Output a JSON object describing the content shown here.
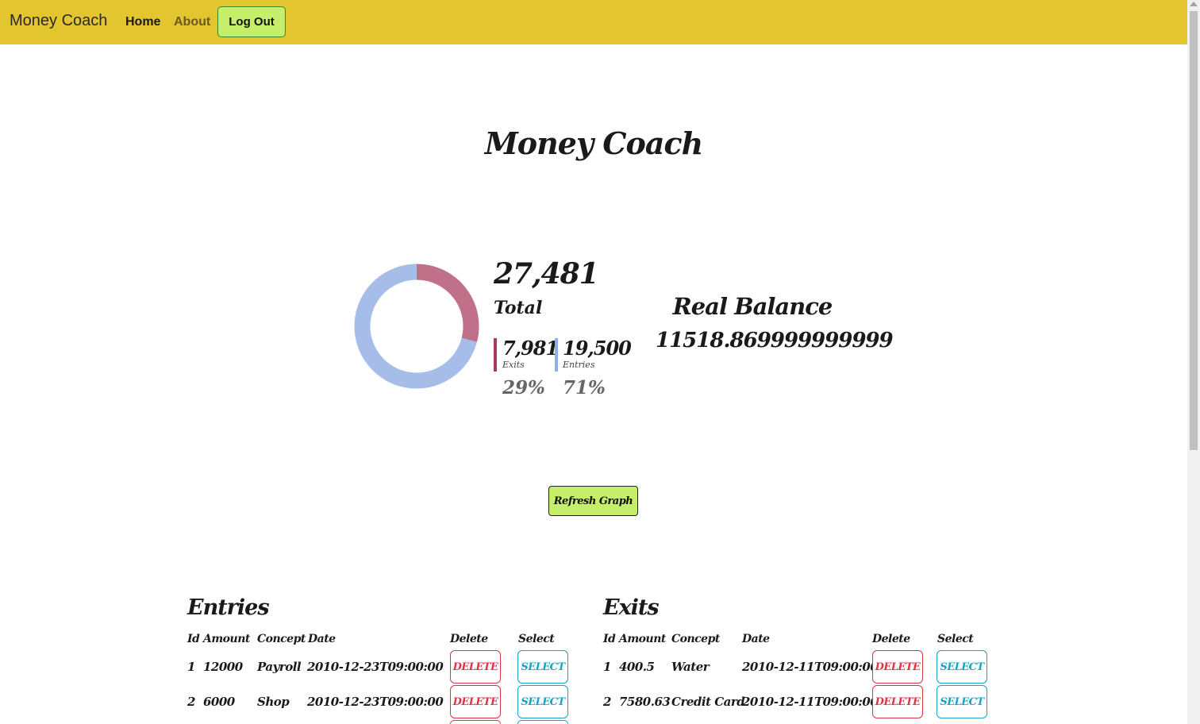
{
  "nav": {
    "brand": "Money Coach",
    "home": "Home",
    "about": "About",
    "logout": "Log Out"
  },
  "page_title": "Money Coach",
  "summary": {
    "total_value": "27,481",
    "total_label": "Total",
    "exits_value": "7,981",
    "exits_label": "Exits",
    "exits_percent": "29%",
    "entries_value": "19,500",
    "entries_label": "Entries",
    "entries_percent": "71%"
  },
  "chart_data": {
    "type": "pie",
    "categories": [
      "Exits",
      "Entries"
    ],
    "values": [
      7981,
      19500
    ],
    "colors": [
      "#c07088",
      "#a5bde8"
    ]
  },
  "real_balance": {
    "title": "Real Balance",
    "value": "11518.869999999999"
  },
  "refresh_button": "Refresh Graph",
  "entries": {
    "title": "Entries",
    "headers": [
      "Id",
      "Amount",
      "Concept",
      "Date",
      "Delete",
      "Select"
    ],
    "rows": [
      {
        "id": "1",
        "amount": "12000",
        "concept": "Payroll",
        "date": "2010-12-23T09:00:00",
        "delete": "DELETE",
        "select": "SELECT"
      },
      {
        "id": "2",
        "amount": "6000",
        "concept": "Shop",
        "date": "2010-12-23T09:00:00",
        "delete": "DELETE",
        "select": "SELECT"
      }
    ]
  },
  "exits": {
    "title": "Exits",
    "headers": [
      "Id",
      "Amount",
      "Concept",
      "Date",
      "Delete",
      "Select"
    ],
    "rows": [
      {
        "id": "1",
        "amount": "400.5",
        "concept": "Water",
        "date": "2010-12-11T09:00:00",
        "delete": "DELETE",
        "select": "SELECT"
      },
      {
        "id": "2",
        "amount": "7580.63",
        "concept": "Credit Card",
        "date": "2010-12-11T09:00:00",
        "delete": "DELETE",
        "select": "SELECT"
      }
    ]
  }
}
